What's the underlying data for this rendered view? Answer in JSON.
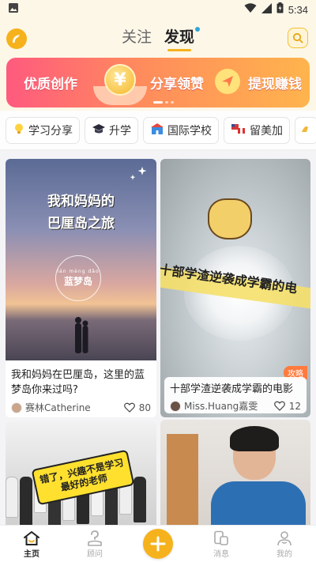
{
  "status_bar": {
    "time": "5:34"
  },
  "header": {
    "tabs": [
      {
        "label": "关注",
        "active": false
      },
      {
        "label": "发现",
        "active": true,
        "has_dot": true
      }
    ],
    "accent_color": "#f6b21c"
  },
  "banner": {
    "texts": [
      "优质创作",
      "分享领赞",
      "提现赚钱"
    ],
    "coin_symbol": "¥",
    "active_index": 0,
    "count": 3
  },
  "categories": [
    {
      "label": "学习分享",
      "icon": "lightbulb-icon"
    },
    {
      "label": "升学",
      "icon": "graduation-cap-icon"
    },
    {
      "label": "国际学校",
      "icon": "school-building-icon"
    },
    {
      "label": "留美加",
      "icon": "flag-icon"
    },
    {
      "label": "",
      "icon": "more-icon"
    }
  ],
  "feed": {
    "cards": [
      {
        "image_title_lines": [
          "我和妈妈的",
          "巴厘岛之旅"
        ],
        "image_pinyin": "lán mèng dǎo",
        "image_place": "蓝梦岛",
        "title": "我和妈妈在巴厘岛，这里的蓝梦岛你来过吗?",
        "author": "赛林Catherine",
        "likes": "80"
      },
      {
        "image_title": "十部学渣逆袭成学霸的电",
        "badge": "攻略",
        "title": "十部学渣逆袭成学霸的电影",
        "author": "Miss.Huang嘉雯",
        "likes": "12"
      },
      {
        "image_caption_lines": [
          "错了，兴趣不是学习",
          "最好的老师"
        ]
      },
      {}
    ]
  },
  "bottom_nav": [
    {
      "label": "主页",
      "icon": "home-icon",
      "active": true
    },
    {
      "label": "顾问",
      "icon": "advisor-icon",
      "active": false
    },
    {
      "label": "",
      "icon": "plus-icon",
      "active": false
    },
    {
      "label": "消息",
      "icon": "message-icon",
      "active": false
    },
    {
      "label": "我的",
      "icon": "profile-icon",
      "active": false
    }
  ]
}
